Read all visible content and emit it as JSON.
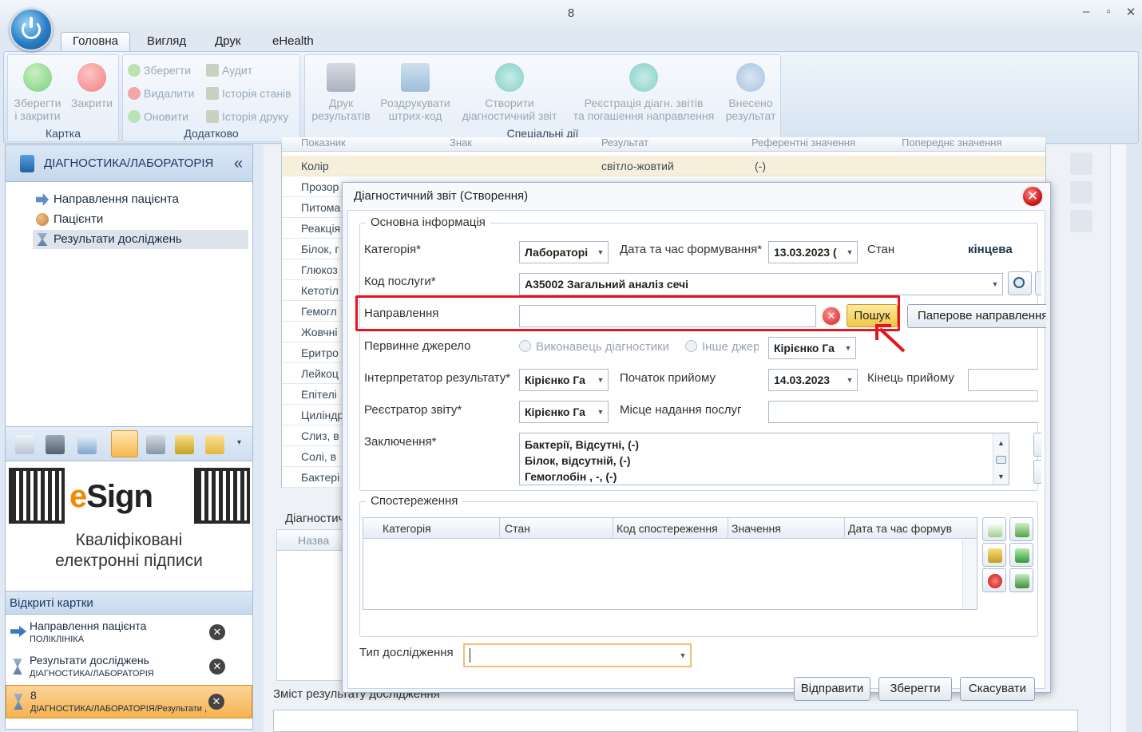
{
  "window": {
    "title": "8",
    "min": "–",
    "max": "▫",
    "close": "✕"
  },
  "tabs": [
    "Головна",
    "Вигляд",
    "Друк",
    "eHealth"
  ],
  "ribbon": {
    "kartka": {
      "label": "Картка",
      "save_close": "Зберегти\nі закрити",
      "close": "Закрити"
    },
    "dodatkovo": {
      "label": "Додатково",
      "save": "Зберегти",
      "delete": "Видалити",
      "refresh": "Оновити",
      "audit": "Аудит",
      "state_history": "Історія станів",
      "print_history": "Історія друку"
    },
    "special": {
      "label": "Спеціальні дії",
      "print_results": "Друк\nрезультатів",
      "print_barcode": "Роздрукувати\nштрих-код",
      "create_report": "Створити\nдіагностичний звіт",
      "register_reports": "Реєстрація діагн. звітів\nта погашення направлення",
      "entered_result": "Внесено\nрезультат"
    }
  },
  "sidebar": {
    "title": "ДІАГНОСТИКА/ЛАБОРАТОРІЯ",
    "collapse": "«",
    "items": [
      "Направлення пацієнта",
      "Пацієнти",
      "Результати досліджень"
    ],
    "ad": {
      "brand_e": "e",
      "brand_rest": "Sign",
      "text1": "Кваліфіковані",
      "text2": "електронні підписи"
    },
    "open_cards_title": "Відкриті картки",
    "open_cards": [
      {
        "title": "Направлення пацієнта",
        "sub": "ПОЛІКЛІНІКА"
      },
      {
        "title": "Результати досліджень",
        "sub": "ДІАГНОСТИКА/ЛАБОРАТОРІЯ"
      },
      {
        "title": "8",
        "sub": "ДІАГНОСТИКА/ЛАБОРАТОРІЯ/Результати ,"
      }
    ],
    "close_glyph": "✕"
  },
  "background": {
    "headers": [
      "Показник",
      "Знак",
      "Результат",
      "Референтні значення",
      "Попереднє значення"
    ],
    "rows": [
      "Колір",
      "Прозор",
      "Питома",
      "Реакція",
      "Білок, г",
      "Глюкоз",
      "Кетотіл",
      "Гемогл",
      "Жовчні",
      "Еритро",
      "Лейкоц",
      "Епітелі",
      "Циліндр",
      "Слиз, в",
      "Солі, в",
      "Бактері"
    ],
    "row1_result": "світло-жовтий",
    "row1_ref": "(-)",
    "section2": "Діагностич",
    "section2_col": "Назва",
    "section3": "Зміст результату дослідження"
  },
  "dialog": {
    "title": "Діагностичний звіт (Створення)",
    "main_info": "Основна інформація",
    "category_label": "Категорія*",
    "category_value": "Лабораторі",
    "datetime_label": "Дата та час формування*",
    "datetime_value": "13.03.2023 (",
    "state_label": "Стан",
    "state_value": "кінцева",
    "service_label": "Код послуги*",
    "service_value": "A35002 Загальний аналіз сечі",
    "referral_label": "Направлення",
    "search_button": "Пошук",
    "paper_referral": "Паперове направлення",
    "source_label": "Первинне джерело",
    "source_opt1": "Виконавець діагностики",
    "source_opt2": "Інше джер",
    "source_person": "Кірієнко Га",
    "interpreter_label": "Інтерпретатор результату*",
    "interpreter_value": "Кірієнко Га",
    "start_label": "Початок прийому",
    "start_value": "14.03.2023",
    "end_label": "Кінець прийому",
    "registrar_label": "Реєстратор звіту*",
    "registrar_value": "Кірієнко Га",
    "place_label": "Місце надання послуг",
    "conclusion_label": "Заключення*",
    "conclusion_lines": [
      "Бактерії, Відсутні,  (-)",
      "Білок, відсутній,  (-)",
      "Гемоглобін  , -,  (-)"
    ],
    "observations": "Спостереження",
    "obs_headers": [
      "Категорія",
      "Стан",
      "Код спостереження",
      "Значення",
      "Дата та час формув"
    ],
    "study_type_label": "Тип дослідження",
    "send": "Відправити",
    "save": "Зберегти",
    "cancel": "Скасувати"
  },
  "colors": {
    "highlight": "#e8141b",
    "search_btn": "#f7d35a",
    "selected_card": "#f7b24e"
  }
}
